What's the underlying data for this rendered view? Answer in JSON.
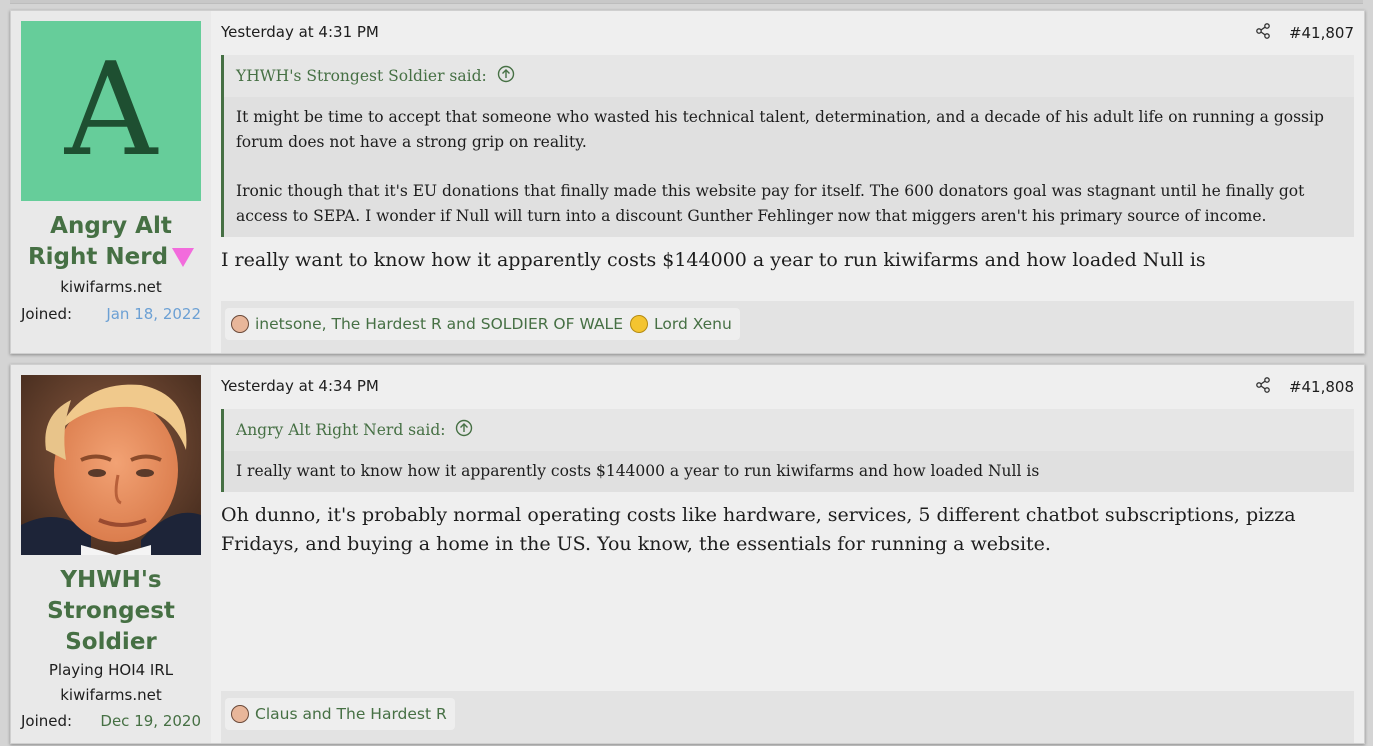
{
  "theme": {
    "accent": "#467044",
    "link_blue": "#6ca0d4",
    "badge_pink": "#f26bdc"
  },
  "posts": [
    {
      "author": {
        "avatar_letter": "A",
        "name": "Angry Alt Right Nerd",
        "site": "kiwifarms.net",
        "joined_label": "Joined:",
        "joined_date": "Jan 18, 2022"
      },
      "date": "Yesterday at 4:31 PM",
      "number": "#41,807",
      "quote": {
        "author": "YHWH's Strongest Soldier said:",
        "paragraphs": [
          "It might be time to accept that someone who wasted his technical talent, determination, and a decade of his adult life on running a gossip forum does not have a strong grip on reality.",
          "Ironic though that it's EU donations that finally made this website pay for itself. The 600 donators goal was stagnant until he finally got access to SEPA. I wonder if Null will turn into a discount Gunther Fehlinger now that miggers aren't his primary source of income."
        ]
      },
      "message": "I really want to know how it apparently costs $144000 a year to run kiwifarms and how loaded Null is",
      "reactions": [
        {
          "icon": "face-emoji-icon",
          "text": "inetsone, The Hardest R and SOLDIER OF WALES"
        },
        {
          "icon": "thinking-emoji-icon",
          "text": "Lord Xenu"
        }
      ]
    },
    {
      "author": {
        "name": "YHWH's Strongest Soldier",
        "user_title": "Playing HOI4 IRL",
        "site": "kiwifarms.net",
        "joined_label": "Joined:",
        "joined_date": "Dec 19, 2020"
      },
      "date": "Yesterday at 4:34 PM",
      "number": "#41,808",
      "quote": {
        "author": "Angry Alt Right Nerd said:",
        "paragraphs": [
          "I really want to know how it apparently costs $144000 a year to run kiwifarms and how loaded Null is"
        ]
      },
      "message": "Oh dunno, it's probably normal operating costs like hardware, services, 5 different chatbot subscriptions, pizza Fridays, and buying a home in the US. You know, the essentials for running a website.",
      "reactions": [
        {
          "icon": "face-emoji-icon",
          "text": "Claus and The Hardest R"
        }
      ]
    }
  ]
}
